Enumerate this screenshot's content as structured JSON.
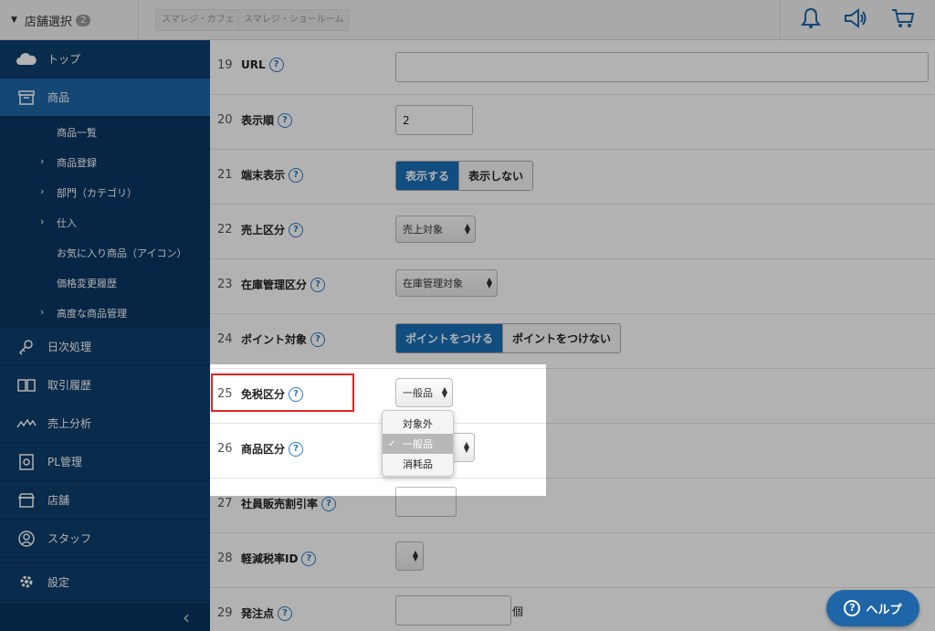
{
  "header": {
    "store_select_label": "店舗選択",
    "store_count": "2",
    "store_tabs": [
      "スマレジ・カフェ",
      "スマレジ・ショールーム"
    ],
    "icons": [
      "bell-icon",
      "megaphone-icon",
      "cart-icon"
    ]
  },
  "sidebar": {
    "items": [
      {
        "label": "トップ",
        "icon": "cloud-icon"
      },
      {
        "label": "商品",
        "icon": "box-icon",
        "active": true
      },
      {
        "label": "日次処理",
        "icon": "key-icon"
      },
      {
        "label": "取引履歴",
        "icon": "book-icon"
      },
      {
        "label": "売上分析",
        "icon": "chart-icon"
      },
      {
        "label": "PL管理",
        "icon": "report-icon"
      },
      {
        "label": "店舗",
        "icon": "store-icon"
      },
      {
        "label": "スタッフ",
        "icon": "person-icon"
      }
    ],
    "sub_items": [
      {
        "label": "商品一覧",
        "chevron": false
      },
      {
        "label": "商品登録",
        "chevron": true
      },
      {
        "label": "部門（カテゴリ）",
        "chevron": true
      },
      {
        "label": "仕入",
        "chevron": true
      },
      {
        "label": "お気に入り商品（アイコン）",
        "chevron": false
      },
      {
        "label": "価格変更履歴",
        "chevron": false
      },
      {
        "label": "高度な商品管理",
        "chevron": true
      }
    ],
    "settings_label": "設定",
    "collapse_glyph": "‹"
  },
  "form": {
    "rows": [
      {
        "num": "19",
        "label": "URL"
      },
      {
        "num": "20",
        "label": "表示順"
      },
      {
        "num": "21",
        "label": "端末表示"
      },
      {
        "num": "22",
        "label": "売上区分"
      },
      {
        "num": "23",
        "label": "在庫管理区分"
      },
      {
        "num": "24",
        "label": "ポイント対象"
      },
      {
        "num": "25",
        "label": "免税区分"
      },
      {
        "num": "26",
        "label": "商品区分"
      },
      {
        "num": "27",
        "label": "社員販売割引率"
      },
      {
        "num": "28",
        "label": "軽減税率ID"
      },
      {
        "num": "29",
        "label": "発注点"
      }
    ],
    "url_value": "",
    "display_order_value": "2",
    "terminal_display": {
      "on": "表示する",
      "off": "表示しない"
    },
    "sales_division_value": "売上対象",
    "stock_management_value": "在庫管理対象",
    "point_target": {
      "on": "ポイントをつける",
      "off": "ポイントをつけない"
    },
    "tax_free_value": "一般品",
    "product_division_value": "",
    "employee_discount_value": "",
    "reduced_tax_value": "",
    "order_point_value": "",
    "order_point_unit": "個",
    "help_symbol": "?"
  },
  "dropdown": {
    "options": [
      "対象外",
      "一般品",
      "消耗品"
    ],
    "selected": "一般品",
    "check": "✓"
  },
  "help_button": {
    "label": "ヘルプ",
    "symbol": "?"
  },
  "colors": {
    "sidebar": "#0d3e6d",
    "active": "#1f66a8",
    "highlight": "#e0241e",
    "accent": "#1a6fb8"
  }
}
